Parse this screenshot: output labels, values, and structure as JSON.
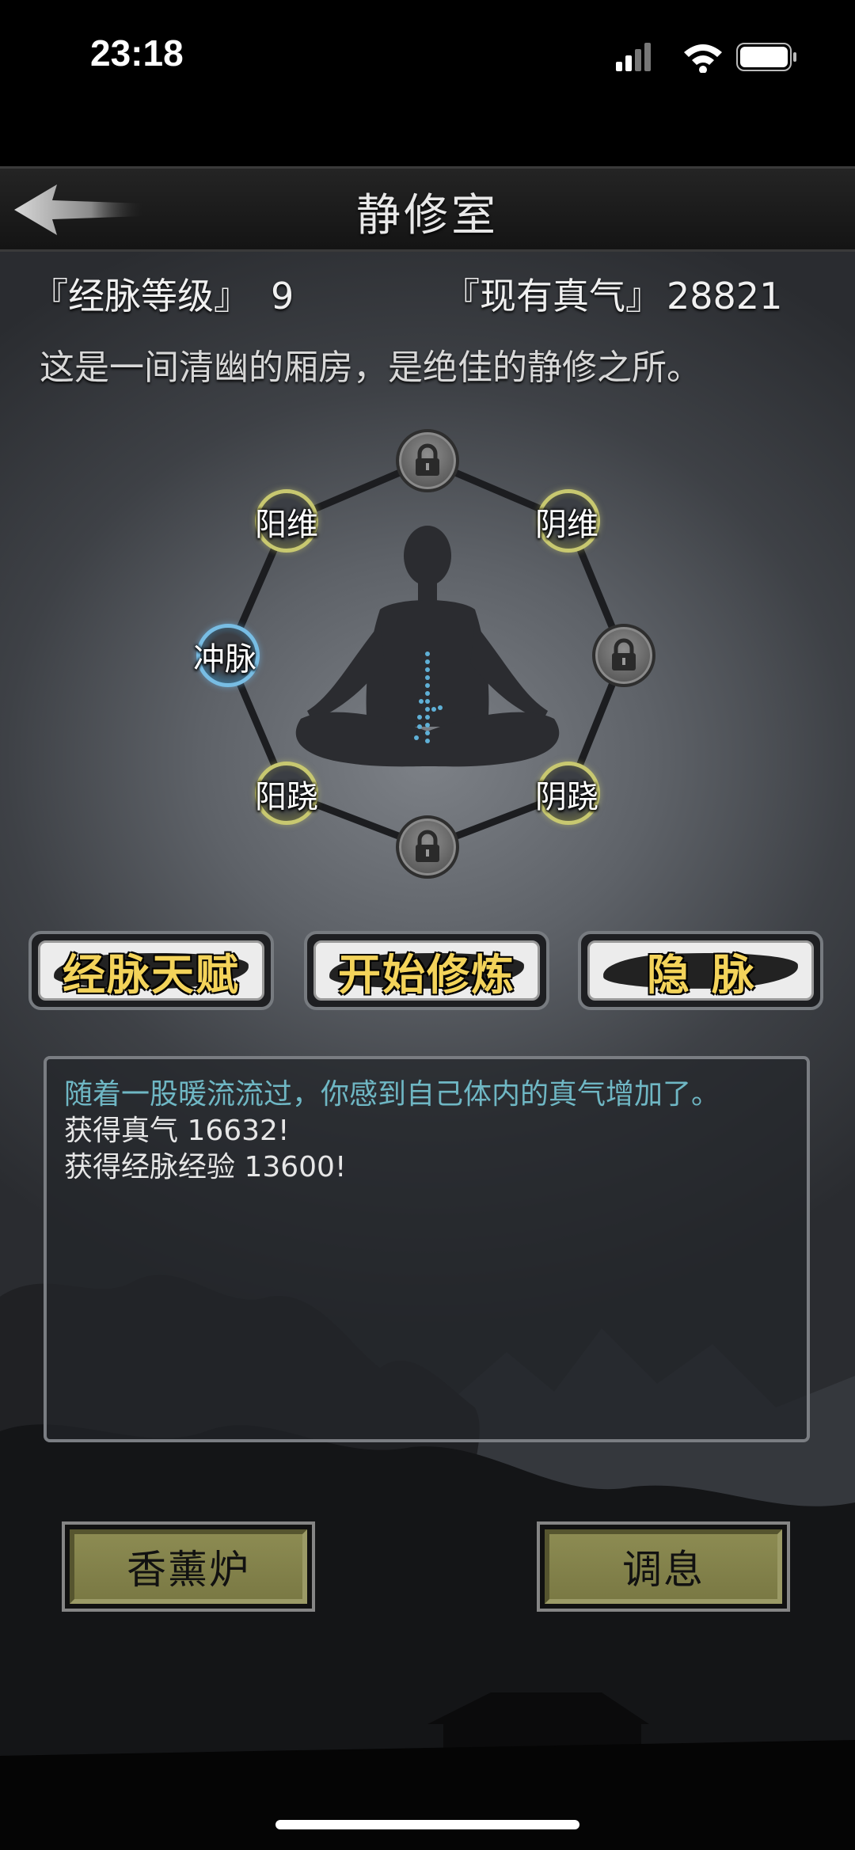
{
  "status_bar": {
    "time": "23:18"
  },
  "header": {
    "title": "静修室",
    "back_icon": "arrow-left-icon"
  },
  "stats": {
    "meridian_level_label": "『经脉等级』",
    "meridian_level_value": "9",
    "qi_label": "『现有真气』",
    "qi_value": "28821"
  },
  "description": "这是一间清幽的厢房，是绝佳的静修之所。",
  "meridians": {
    "yang_wei": "阳维",
    "yin_wei": "阴维",
    "chong_mai": "冲脉",
    "yang_qiao": "阳跷",
    "yin_qiao": "阴跷",
    "locked_icon": "padlock-icon"
  },
  "actions": {
    "talent": "经脉天赋",
    "start": "开始修炼",
    "hidden": "隐脉"
  },
  "log": [
    "随着一股暖流流过，你感到自己体内的真气增加了。",
    "获得真气 16632!",
    "获得经脉经验 13600!"
  ],
  "bottom": {
    "incense": "香薰炉",
    "rest": "调息"
  },
  "colors": {
    "active_node_ring": "#c8c870",
    "chong_node_ring": "#78bde4",
    "log_highlight": "#6fb7c4",
    "button_text": "#f3d35a",
    "bottom_button_fill": "#8c8b52"
  }
}
